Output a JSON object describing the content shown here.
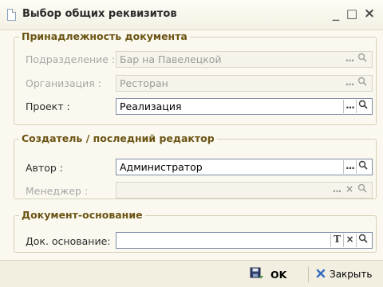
{
  "window": {
    "title": "Выбор общих реквизитов",
    "controls": {
      "minimize": "_",
      "maximize": "□",
      "close": "×"
    }
  },
  "groups": {
    "ownership": {
      "title": "Принадлежность документа",
      "fields": {
        "department": {
          "label": "Подразделение :",
          "value": "Бар на Павелецкой",
          "enabled": false
        },
        "organization": {
          "label": "Организация :",
          "value": "Ресторан",
          "enabled": false
        },
        "project": {
          "label": "Проект :",
          "value": "Реализация",
          "enabled": true
        }
      }
    },
    "author": {
      "title": "Создатель / последний редактор",
      "fields": {
        "author": {
          "label": "Автор :",
          "value": "Администратор",
          "enabled": true
        },
        "manager": {
          "label": "Менеджер :",
          "value": "",
          "enabled": false
        }
      }
    },
    "basis": {
      "title": "Документ-основание",
      "fields": {
        "basis": {
          "label": "Док. основание:",
          "value": "",
          "enabled": true
        }
      }
    }
  },
  "buttons": {
    "choose": "...",
    "clear": "×",
    "text": "T",
    "search": "search-icon"
  },
  "footer": {
    "ok": "OK",
    "close": "Закрыть"
  },
  "colors": {
    "group_title": "#6b5413",
    "window_bg": "#fbf9ef",
    "close_x": "#3b6fc2"
  }
}
